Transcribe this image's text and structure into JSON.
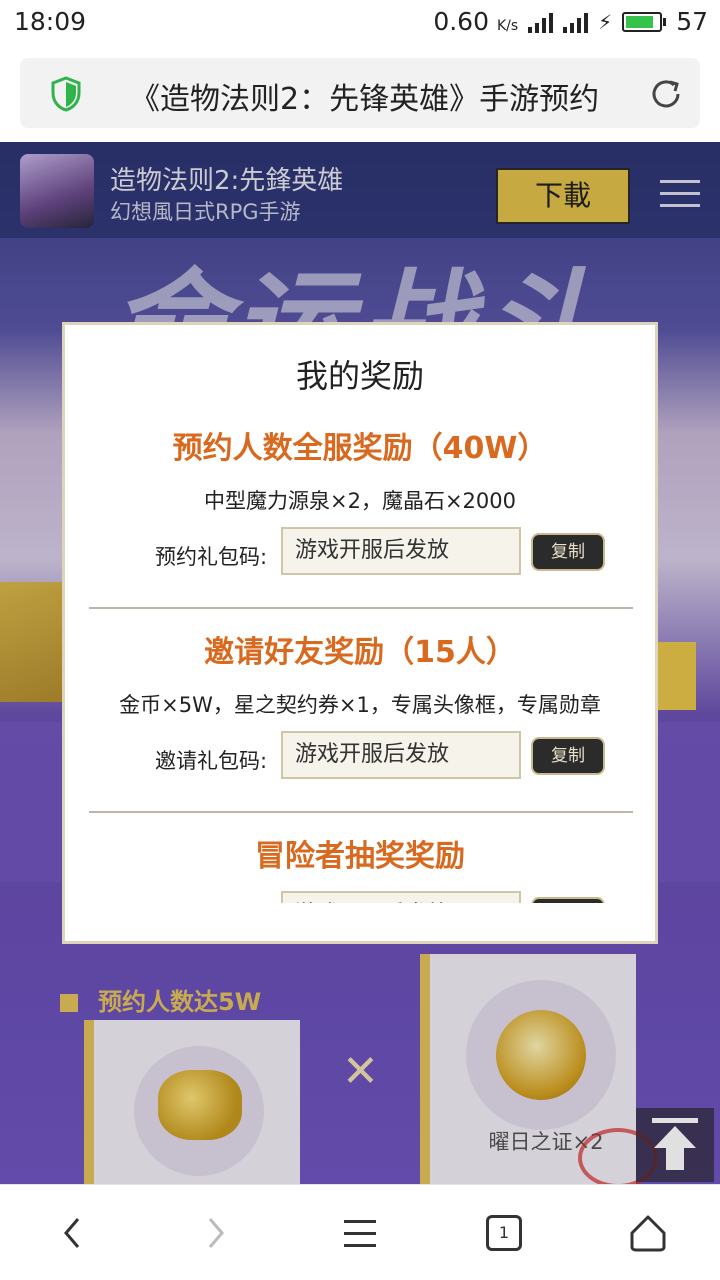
{
  "status_bar": {
    "time": "18:09",
    "net_speed": "0.60",
    "net_unit": "K/s",
    "battery": "57"
  },
  "browser": {
    "page_title": "《造物法则2：先锋英雄》手游预约"
  },
  "game_header": {
    "name": "造物法则2:先鋒英雄",
    "subtitle": "幻想風日式RPG手游",
    "download_label": "下載"
  },
  "banner": {
    "text": "命运战斗"
  },
  "modal": {
    "title": "我的奖励",
    "sections": [
      {
        "title": "预约人数全服奖励（40W）",
        "desc": "中型魔力源泉×2，魔晶石×2000",
        "code_label": "预约礼包码:",
        "code_value": "游戏开服后发放",
        "copy_label": "复制"
      },
      {
        "title": "邀请好友奖励（15人）",
        "desc": "金币×5W，星之契约券×1，专属头像框，专属勋章",
        "code_label": "邀请礼包码:",
        "code_value": "游戏开服后发放",
        "copy_label": "复制"
      },
      {
        "title": "冒险者抽奖奖励",
        "code_value": "游戏开服后发放"
      }
    ]
  },
  "rewards": {
    "reach_label": "预约人数达5W",
    "medal_label": "曜日之证×2"
  },
  "navbar": {
    "tab_count": "1"
  },
  "colors": {
    "accent_orange": "#d9691e",
    "gold": "#e2c24a",
    "purple": "#6a4fb8"
  }
}
